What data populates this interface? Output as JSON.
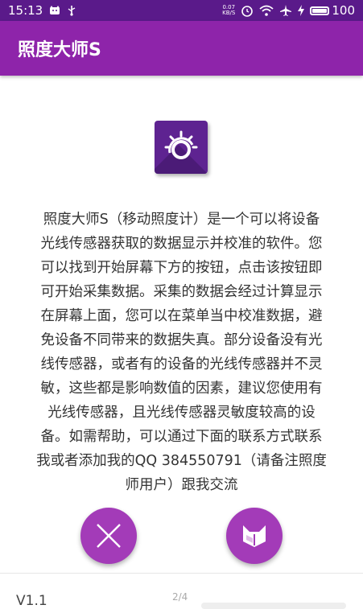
{
  "status_bar": {
    "time": "15:13",
    "net_speed_value": "0.07",
    "net_speed_unit": "KB/S",
    "battery_level": "100"
  },
  "app_bar": {
    "title": "照度大师S"
  },
  "description_lines": [
    "照度大师S（移动照度计）是一个可以将设备",
    "光线传感器获取的数据显示并校准的软件。您",
    "可以找到开始屏幕下方的按钮，点击该按钮即",
    "可开始采集数据。采集的数据会经过计算显示",
    "在屏幕上面，您可以在菜单当中校准数据，避",
    "免设备不同带来的数据失真。部分设备没有光",
    "线传感器，或者有的设备的光线传感器并不灵",
    "敏，这些都是影响数值的因素，建议您使用有",
    "光线传感器，且光线传感器灵敏度较高的设",
    "备。如需帮助，可以通过下面的联系方式联系",
    "我或者添加我的QQ 384550791（请备注照度",
    "师用户）跟我交流"
  ],
  "footer": {
    "version": "V1.1",
    "page_indicator": "2/4"
  },
  "colors": {
    "status_bar": "#5a1a8a",
    "app_bar": "#8e24aa",
    "fab": "#a33bb8",
    "logo": "#5e2391"
  },
  "icons": {
    "close_fab": "close-icon",
    "read_fab": "fox-book-icon",
    "logo": "sun-logo-icon"
  }
}
